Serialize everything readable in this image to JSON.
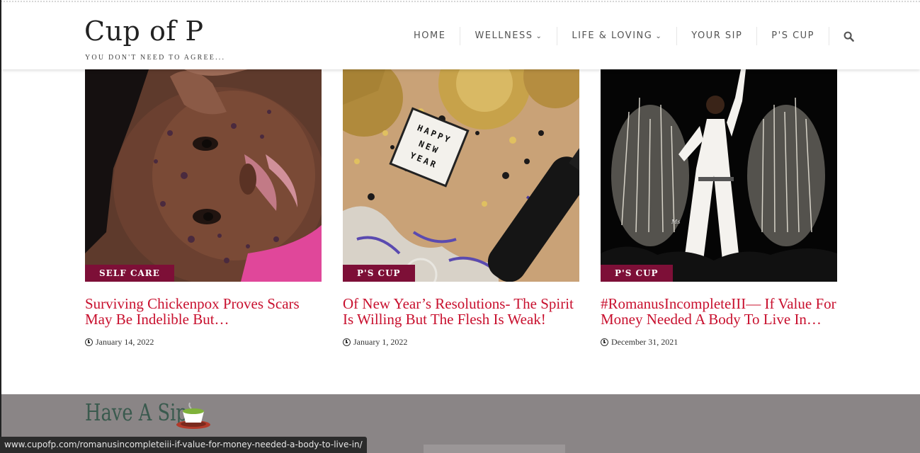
{
  "site": {
    "logo": "Cup of P",
    "tagline": "YOU DON'T NEED TO AGREE..."
  },
  "nav": {
    "items": [
      {
        "label": "HOME",
        "has_dropdown": false
      },
      {
        "label": "WELLNESS",
        "has_dropdown": true
      },
      {
        "label": "LIFE & LOVING",
        "has_dropdown": true
      },
      {
        "label": "YOUR SIP",
        "has_dropdown": false
      },
      {
        "label": "P'S CUP",
        "has_dropdown": false
      }
    ],
    "search_icon": "search-icon"
  },
  "posts": [
    {
      "category": "SELF CARE",
      "title": "Surviving Chickenpox Proves Scars May Be Indelible But…",
      "date": "January 14, 2022"
    },
    {
      "category": "P'S CUP",
      "title": "Of New Year’s Resolutions- The Spirit Is Willing But The Flesh Is Weak!",
      "date": "January 1, 2022"
    },
    {
      "category": "P'S CUP",
      "title": "#RomanusIncompleteIII— If Value For Money Needed A Body To Live In…",
      "date": "December 31, 2021"
    }
  ],
  "section": {
    "title": "Have A Sip",
    "icon": "tea-cup-icon"
  },
  "status_bar": {
    "url": "www.cupofp.com/romanusincompleteiii-if-value-for-money-needed-a-body-to-live-in/"
  },
  "colors": {
    "badge": "#7d0f37",
    "title_link": "#c8102e",
    "section_bg": "#8a8586",
    "section_title": "#3a5a4e"
  }
}
